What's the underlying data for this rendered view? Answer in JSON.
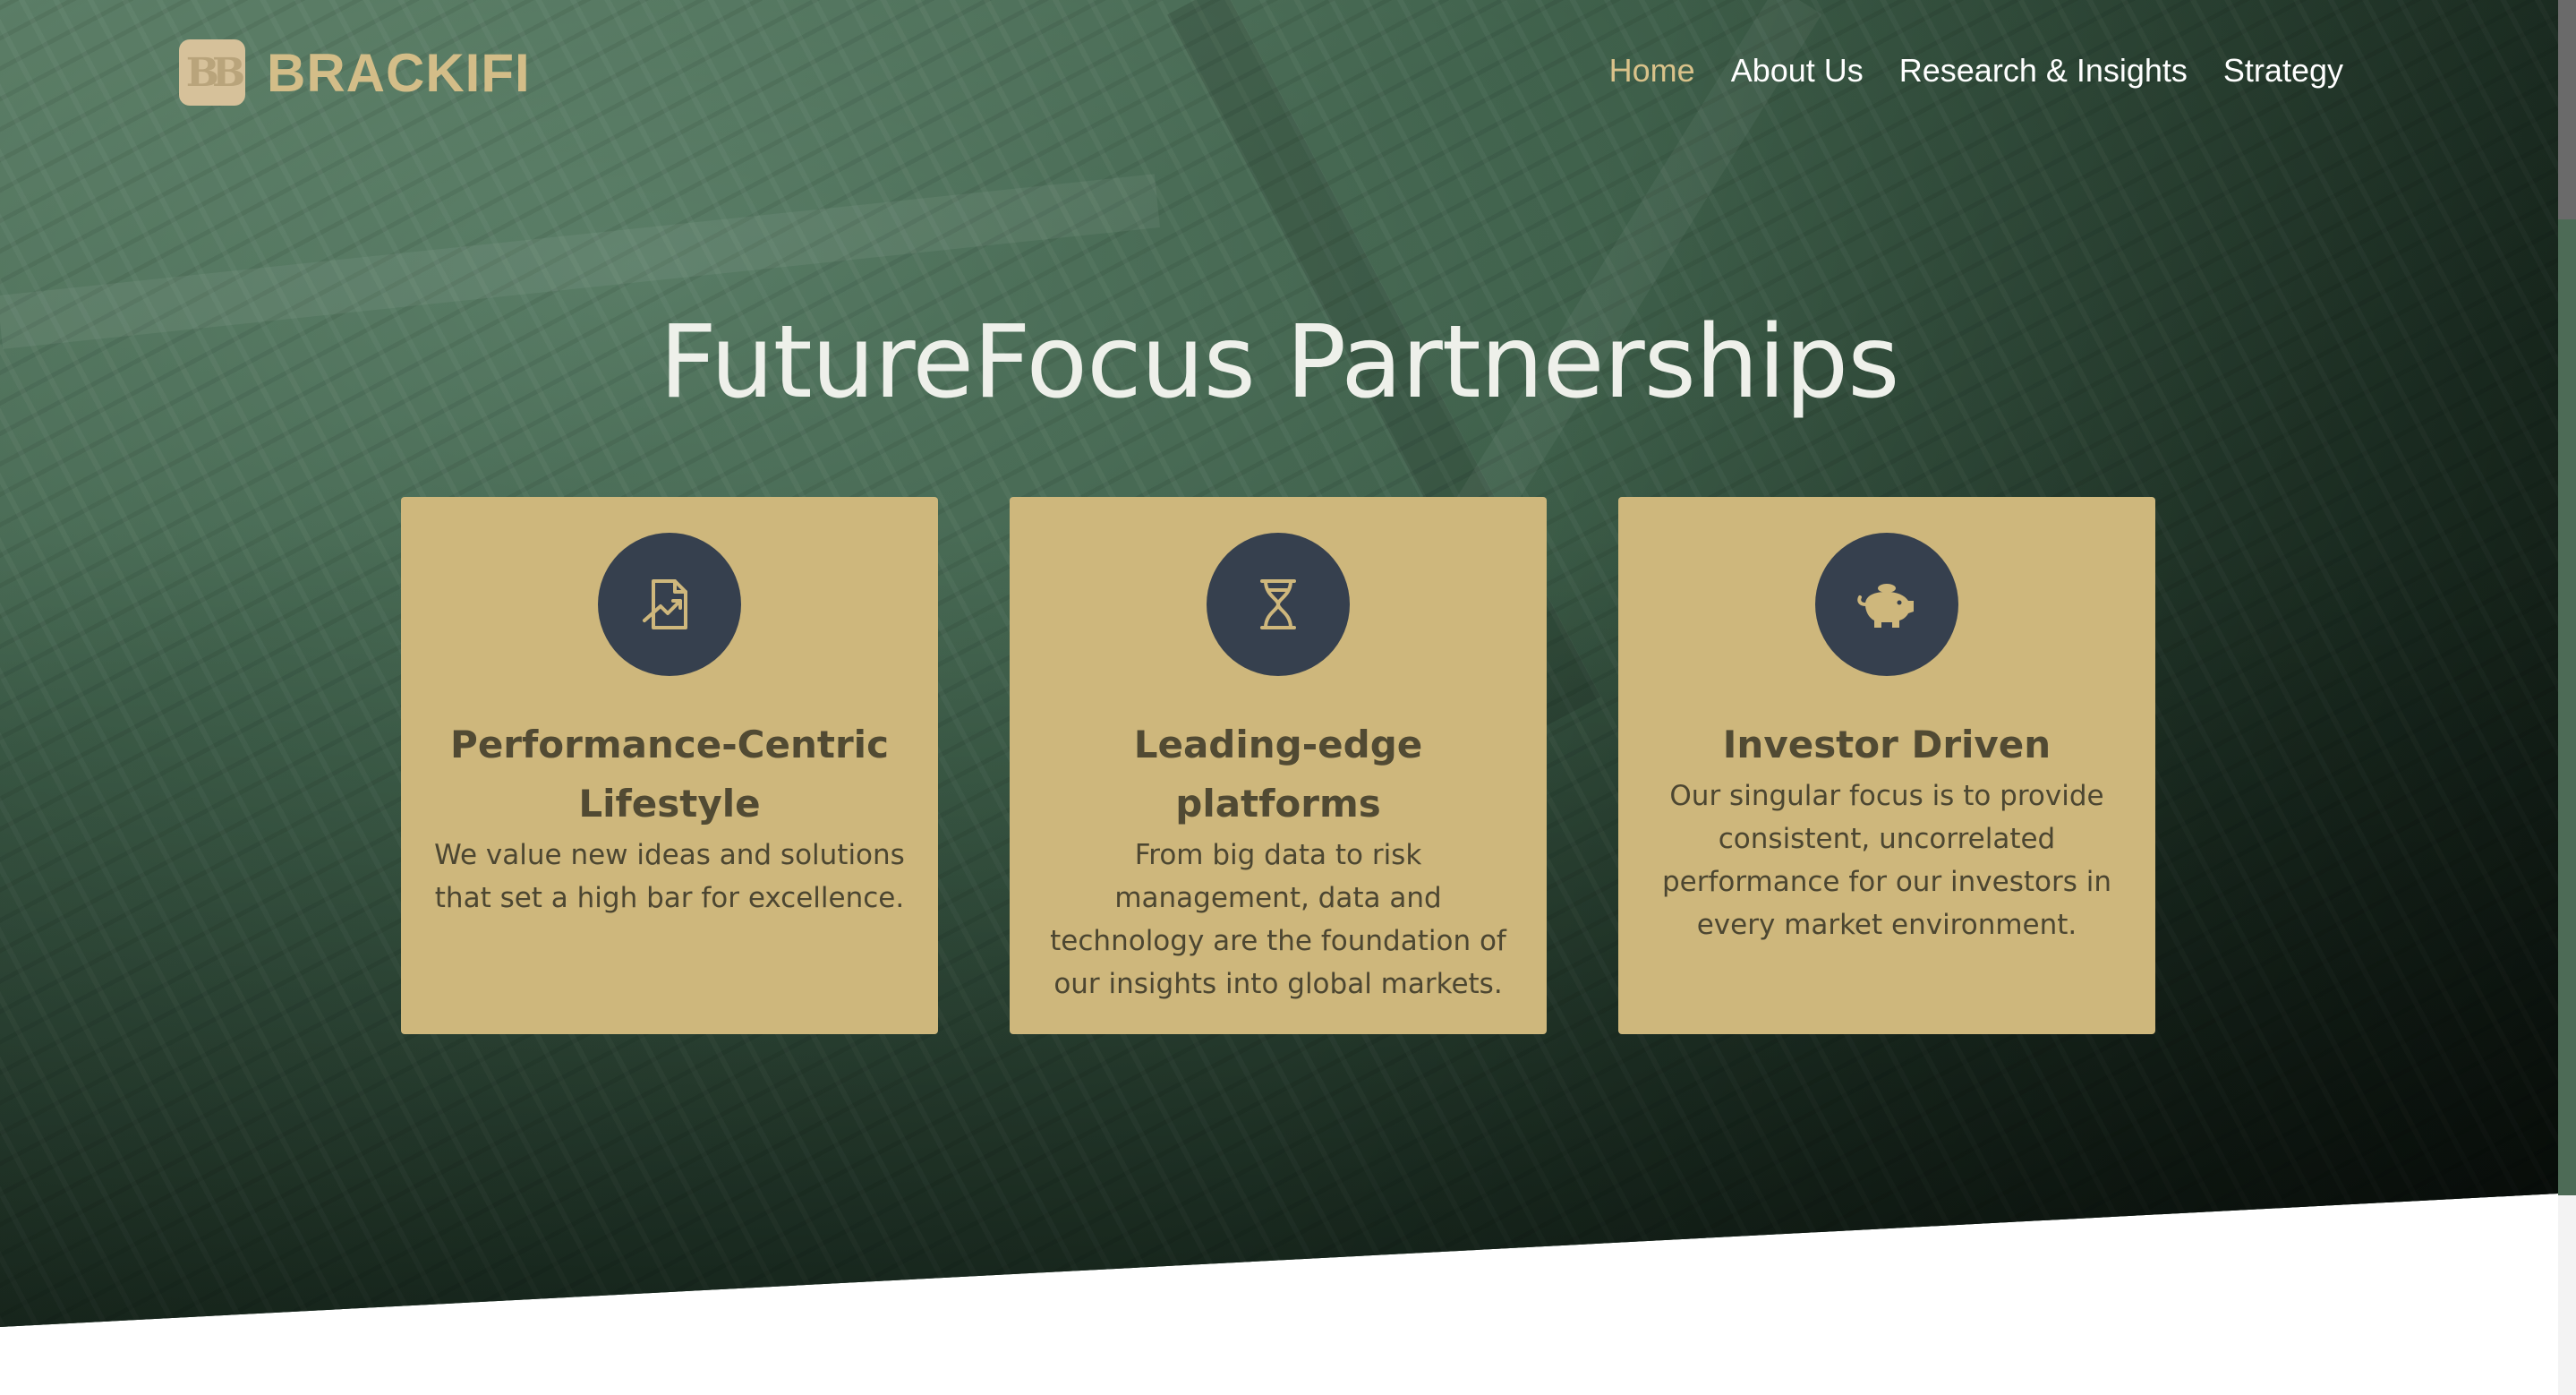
{
  "brand": {
    "name": "BRACKIFI",
    "mark": "BB"
  },
  "nav": {
    "items": [
      {
        "label": "Home",
        "active": true
      },
      {
        "label": "About Us",
        "active": false
      },
      {
        "label": "Research & Insights",
        "active": false
      },
      {
        "label": "Strategy",
        "active": false
      }
    ]
  },
  "hero": {
    "title": "FutureFocus Partnerships"
  },
  "cards": [
    {
      "icon": "document-chart-icon",
      "title": "Performance-Centric Lifestyle",
      "text": "We value new ideas and solutions that set a high bar for excellence."
    },
    {
      "icon": "hourglass-icon",
      "title": "Leading-edge platforms",
      "text": "From big data to risk management, data and technology are the foundation of our insights into global markets."
    },
    {
      "icon": "piggy-bank-icon",
      "title": "Investor Driven",
      "text": "Our singular focus is to provide consistent, uncorrelated performance for our investors in every market environment."
    }
  ],
  "colors": {
    "accent_gold": "#d3bd88",
    "card_bg": "#ceb77c",
    "icon_circle": "#36404e",
    "hero_green": "#3e5f4a"
  }
}
